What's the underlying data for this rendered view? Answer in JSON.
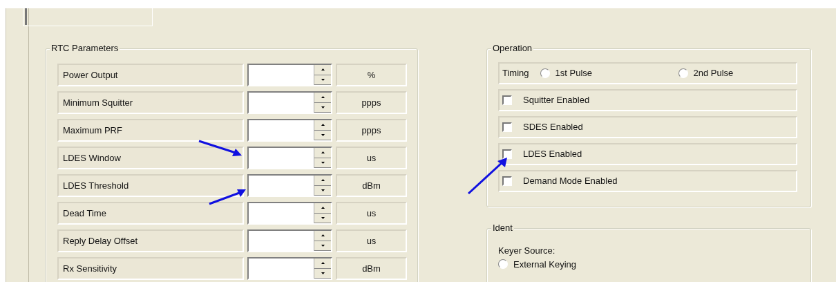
{
  "rtc_parameters": {
    "title": "RTC Parameters",
    "rows": [
      {
        "label": "Power Output",
        "unit": "%"
      },
      {
        "label": "Minimum Squitter",
        "unit": "ppps"
      },
      {
        "label": "Maximum PRF",
        "unit": "ppps"
      },
      {
        "label": "LDES Window",
        "unit": "us"
      },
      {
        "label": "LDES Threshold",
        "unit": "dBm"
      },
      {
        "label": "Dead Time",
        "unit": "us"
      },
      {
        "label": "Reply Delay Offset",
        "unit": "us"
      },
      {
        "label": "Rx Sensitivity",
        "unit": "dBm"
      }
    ]
  },
  "operation": {
    "title": "Operation",
    "timing": {
      "label": "Timing",
      "options": [
        {
          "label": "1st Pulse",
          "selected": false
        },
        {
          "label": "2nd Pulse",
          "selected": false
        }
      ]
    },
    "checkboxes": [
      {
        "label": "Squitter Enabled",
        "checked": false
      },
      {
        "label": "SDES Enabled",
        "checked": false
      },
      {
        "label": "LDES Enabled",
        "checked": false
      },
      {
        "label": "Demand Mode Enabled",
        "checked": false
      }
    ]
  },
  "ident": {
    "title": "Ident",
    "keyer_source_label": "Keyer Source:",
    "options": [
      {
        "label": "External Keying",
        "selected": false
      }
    ]
  }
}
